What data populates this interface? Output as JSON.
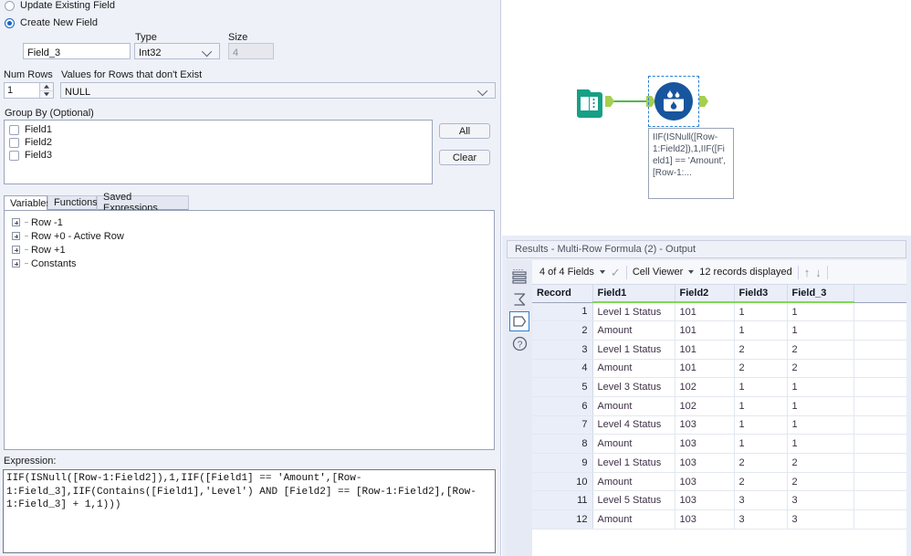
{
  "config": {
    "mode_options": [
      {
        "label": "Update Existing Field",
        "selected": false
      },
      {
        "label": "Create New  Field",
        "selected": true
      }
    ],
    "field_name": {
      "label": "",
      "value": "Field_3"
    },
    "type": {
      "label": "Type",
      "value": "Int32"
    },
    "size": {
      "label": "Size",
      "value": "4"
    },
    "num_rows": {
      "label": "Num Rows",
      "value": "1"
    },
    "values_missing": {
      "label": "Values for Rows that don't Exist",
      "value": "NULL"
    },
    "group_by": {
      "label": "Group By (Optional)",
      "items": [
        {
          "label": "Field1",
          "checked": false
        },
        {
          "label": "Field2",
          "checked": false
        },
        {
          "label": "Field3",
          "checked": false
        }
      ],
      "all_button": "All",
      "clear_button": "Clear"
    },
    "tabs": [
      {
        "label": "Variables",
        "active": true
      },
      {
        "label": "Functions",
        "active": false
      },
      {
        "label": "Saved Expressions",
        "active": false
      }
    ],
    "variables_tree": [
      {
        "label": "Row -1"
      },
      {
        "label": "Row +0 - Active Row"
      },
      {
        "label": "Row +1"
      },
      {
        "label": "Constants"
      }
    ],
    "expression": {
      "label": "Expression:",
      "value": "IIF(ISNull([Row-1:Field2]),1,IIF([Field1] == 'Amount',[Row-1:Field_3],IIF(Contains([Field1],'Level') AND [Field2] == [Row-1:Field2],[Row-1:Field_3] + 1,1)))"
    }
  },
  "canvas": {
    "tools": [
      {
        "name": "text-input-tool",
        "icon": "book-icon"
      },
      {
        "name": "multi-row-formula-tool",
        "icon": "multi-row-formula-icon",
        "selected": true
      }
    ],
    "annotation": "IIF(ISNull([Row-1:Field2]),1,IIF([Field1] == 'Amount',[Row-1:..."
  },
  "results": {
    "title": "Results - Multi-Row Formula (2) - Output",
    "sidebar_icons": [
      {
        "name": "data-grid-icon",
        "selected": false
      },
      {
        "name": "summary-sigma-icon",
        "selected": false
      },
      {
        "name": "metadata-tag-icon",
        "selected": true
      },
      {
        "name": "help-question-icon",
        "selected": false
      }
    ],
    "toolbar": {
      "fields_selector": "4 of 4 Fields",
      "check_icon": "check-icon",
      "view_mode": "Cell Viewer",
      "record_count": "12 records displayed",
      "up_icon": "arrow-up-icon",
      "down_icon": "arrow-down-icon"
    },
    "grid": {
      "columns": [
        "Record",
        "Field1",
        "Field2",
        "Field3",
        "Field_3"
      ],
      "rows": [
        [
          "1",
          "Level 1 Status",
          "101",
          "1",
          "1"
        ],
        [
          "2",
          "Amount",
          "101",
          "1",
          "1"
        ],
        [
          "3",
          "Level 1 Status",
          "101",
          "2",
          "2"
        ],
        [
          "4",
          "Amount",
          "101",
          "2",
          "2"
        ],
        [
          "5",
          "Level 3 Status",
          "102",
          "1",
          "1"
        ],
        [
          "6",
          "Amount",
          "102",
          "1",
          "1"
        ],
        [
          "7",
          "Level 4 Status",
          "103",
          "1",
          "1"
        ],
        [
          "8",
          "Amount",
          "103",
          "1",
          "1"
        ],
        [
          "9",
          "Level 1 Status",
          "103",
          "2",
          "2"
        ],
        [
          "10",
          "Amount",
          "103",
          "2",
          "2"
        ],
        [
          "11",
          "Level 5 Status",
          "103",
          "3",
          "3"
        ],
        [
          "12",
          "Amount",
          "103",
          "3",
          "3"
        ]
      ]
    }
  },
  "colors": {
    "accent_blue": "#1669c6",
    "tool_blue": "#17559e",
    "tool_teal": "#16a085",
    "connector_green": "#51b848",
    "header_underline_green": "#7ed957",
    "panel_bg": "#eef1f8"
  }
}
